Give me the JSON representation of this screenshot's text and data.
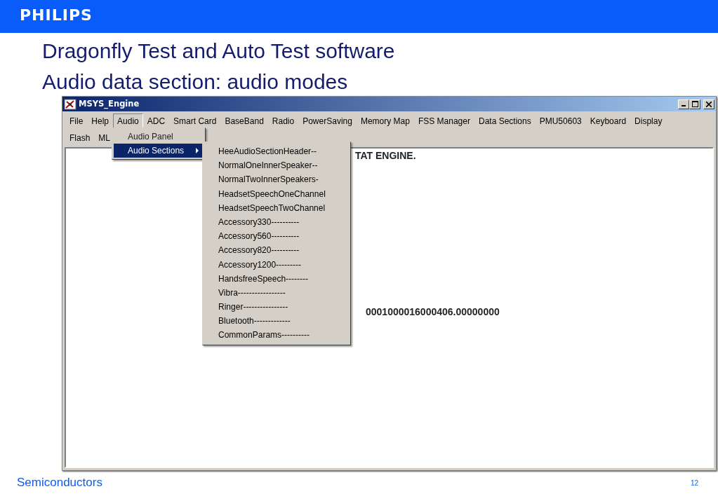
{
  "header": {
    "logo": "PHILIPS"
  },
  "titles": [
    "Dragonfly Test and Auto Test software",
    "Audio data section: audio modes"
  ],
  "window": {
    "title": "MSYS_Engine",
    "menu_bar": [
      {
        "label": "File",
        "selected": false
      },
      {
        "label": "Help",
        "selected": false
      },
      {
        "label": "Audio",
        "selected": true
      },
      {
        "label": "ADC",
        "selected": false
      },
      {
        "label": "Smart Card",
        "selected": false
      },
      {
        "label": "BaseBand",
        "selected": false
      },
      {
        "label": "Radio",
        "selected": false
      },
      {
        "label": "PowerSaving",
        "selected": false
      },
      {
        "label": "Memory Map",
        "selected": false
      },
      {
        "label": "FSS Manager",
        "selected": false
      },
      {
        "label": "Data Sections",
        "selected": false
      },
      {
        "label": "PMU50603",
        "selected": false
      },
      {
        "label": "Keyboard",
        "selected": false
      },
      {
        "label": "Display",
        "selected": false
      },
      {
        "label": "Flash",
        "selected": false
      },
      {
        "label": "ML",
        "selected": false
      }
    ],
    "open_menu": [
      {
        "label": "Audio Panel",
        "selected": false
      },
      {
        "label": "Audio Sections",
        "selected": true,
        "submenu": [
          "HeeAudioSectionHeader--",
          "NormalOneInnerSpeaker--",
          "NormalTwoInnerSpeakers-",
          "HeadsetSpeechOneChannel",
          "HeadsetSpeechTwoChannel",
          "Accessory330----------",
          "Accessory560----------",
          "Accessory820----------",
          "Accessory1200---------",
          "HandsfreeSpeech--------",
          "Vibra-----------------",
          "Ringer----------------",
          "Bluetooth-------------",
          "CommonParams----------"
        ]
      }
    ],
    "content": [
      "TAT ENGINE.",
      "0001000016000406.00000000"
    ]
  },
  "footer": {
    "left": "Semiconductors",
    "page": "12"
  }
}
